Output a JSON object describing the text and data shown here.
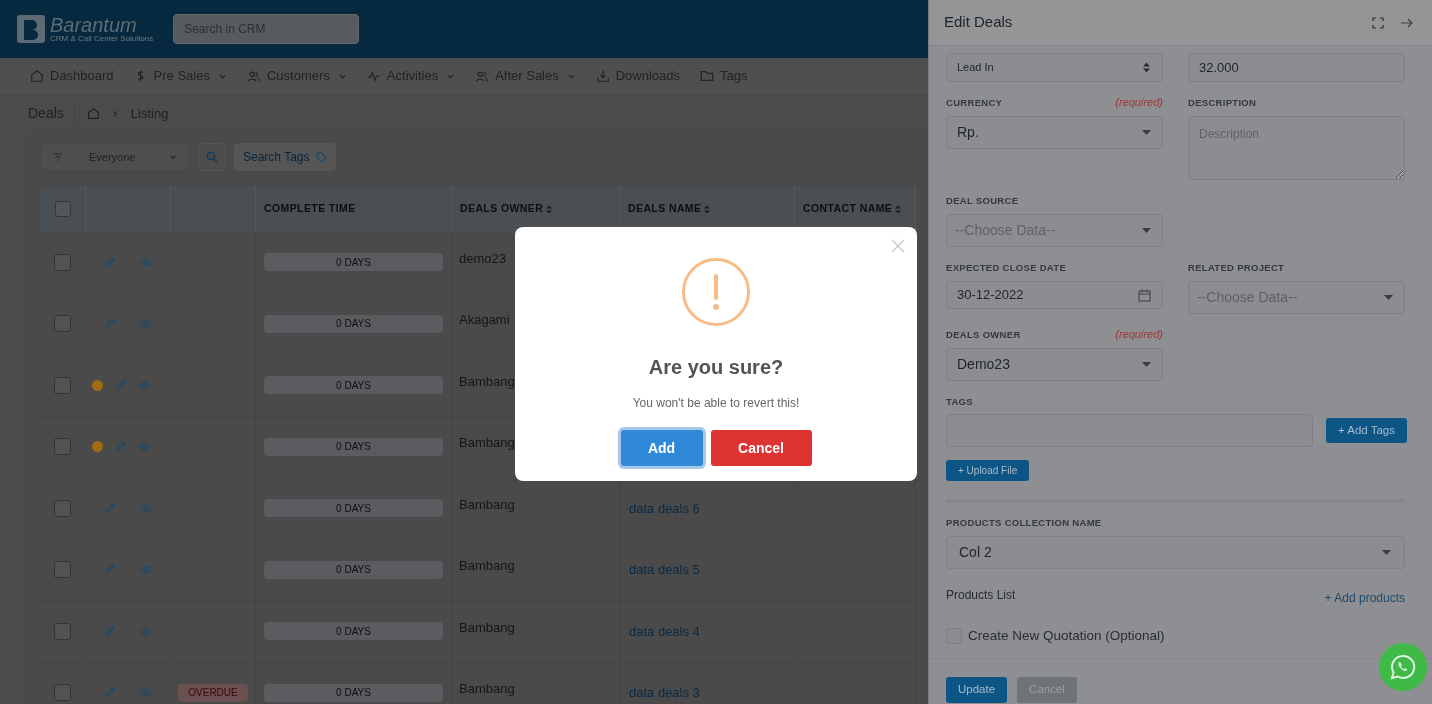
{
  "header": {
    "logo_text": "Barantum",
    "logo_tagline": "CRM & Call Center Solutions",
    "search_placeholder": "Search in CRM"
  },
  "nav": [
    {
      "label": "Dashboard",
      "dropdown": false
    },
    {
      "label": "Pre Sales",
      "dropdown": true
    },
    {
      "label": "Customers",
      "dropdown": true
    },
    {
      "label": "Activities",
      "dropdown": true
    },
    {
      "label": "After Sales",
      "dropdown": true
    },
    {
      "label": "Downloads",
      "dropdown": false
    },
    {
      "label": "Tags",
      "dropdown": false
    }
  ],
  "breadcrumb": {
    "title": "Deals",
    "current": "Listing"
  },
  "filter": {
    "owner": "Everyone",
    "tags_button": "Search Tags"
  },
  "table": {
    "select_all_checked": false,
    "columns": [
      {
        "label": "COMPLETE TIME",
        "sortable": false
      },
      {
        "label": "DEALS OWNER",
        "sortable": true
      },
      {
        "label": "DEALS NAME",
        "sortable": true
      },
      {
        "label": "CONTACT NAME",
        "sortable": true
      }
    ],
    "rows": [
      {
        "checked": false,
        "info": false,
        "complete_time": "0 DAYS",
        "owner": "demo23"
      },
      {
        "checked": false,
        "info": false,
        "complete_time": "0 DAYS",
        "owner": "Akagami"
      },
      {
        "checked": false,
        "info": true,
        "complete_time": "0 DAYS",
        "owner": "Bambang"
      },
      {
        "checked": false,
        "info": true,
        "complete_time": "0 DAYS",
        "owner": "Bambang"
      },
      {
        "checked": false,
        "info": false,
        "complete_time": "0 DAYS",
        "owner": "Bambang",
        "deal_name": "data deals 6"
      },
      {
        "checked": false,
        "info": false,
        "complete_time": "0 DAYS",
        "owner": "Bambang",
        "deal_name": "data deals 5"
      },
      {
        "checked": false,
        "info": false,
        "complete_time": "0 DAYS",
        "owner": "Bambang",
        "deal_name": "data deals 4"
      },
      {
        "checked": false,
        "info": false,
        "overdue": "OVERDUE",
        "complete_time": "0 DAYS",
        "owner": "Bambang",
        "deal_name": "data deals 3"
      }
    ]
  },
  "panel": {
    "title": "Edit Deals",
    "rows": [
      [
        {
          "kind": "spinner",
          "value": "Lead In"
        },
        {
          "kind": "input",
          "value": "32.000"
        }
      ],
      [
        {
          "kind": "select",
          "label": "CURRENCY",
          "required": "(required)",
          "value": "Rp."
        },
        {
          "kind": "textarea",
          "label": "DESCRIPTION",
          "placeholder": "Description"
        }
      ],
      [
        {
          "kind": "select",
          "label": "DEAL SOURCE",
          "placeholder": "--Choose Data--"
        }
      ],
      [
        {
          "kind": "date",
          "label": "EXPECTED CLOSE DATE",
          "value": "30-12-2022"
        },
        {
          "kind": "select",
          "label": "RELATED PROJECT",
          "placeholder": "--Choose Data--"
        }
      ],
      [
        {
          "kind": "select",
          "label": "DEALS OWNER",
          "required": "(required)",
          "value": "Demo23"
        }
      ]
    ],
    "tags_label": "TAGS",
    "add_tags": "+ Add Tags",
    "upload": "+ Upload File",
    "collection_label": "PRODUCTS COLLECTION NAME",
    "collection_value": "Col 2",
    "products_list": "Products List",
    "add_products": "+ Add products",
    "quotation": {
      "label": "Create New Quotation (Optional)",
      "checked": false
    },
    "update": "Update",
    "cancel": "Cancel"
  },
  "modal": {
    "title": "Are you sure?",
    "text": "You won't be able to revert this!",
    "confirm": "Add",
    "cancel": "Cancel"
  }
}
